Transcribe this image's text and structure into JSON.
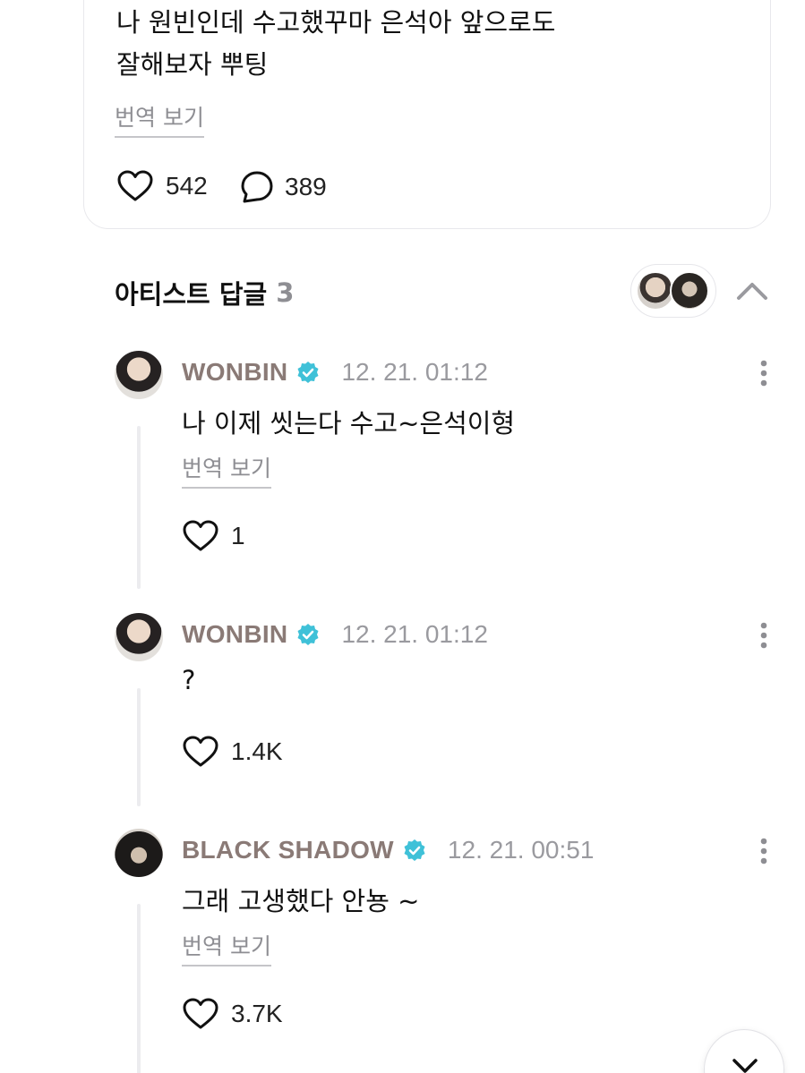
{
  "post": {
    "text": "나 원빈인데 수고했꾸마 은석아 앞으로도\n잘해보자 뿌팅",
    "translate_label": "번역 보기",
    "like_count": "542",
    "comment_count": "389"
  },
  "artist_replies": {
    "title": "아티스트 답글",
    "count": "3"
  },
  "comments": [
    {
      "author": "WONBIN",
      "time": "12. 21. 01:12",
      "text": "나 이제 씻는다 수고~은석이형",
      "translate_label": "번역 보기",
      "likes": "1"
    },
    {
      "author": "WONBIN",
      "time": "12. 21. 01:12",
      "text": "?",
      "likes": "1.4K"
    },
    {
      "author": "BLACK SHADOW",
      "time": "12. 21. 00:51",
      "text": "그래 고생했다 안뇽 ~",
      "translate_label": "번역 보기",
      "likes": "3.7K"
    }
  ],
  "colors": {
    "author_name": "#8a7a76",
    "verified_badge": "#3fc1d8",
    "muted_text": "#8e8e93"
  }
}
